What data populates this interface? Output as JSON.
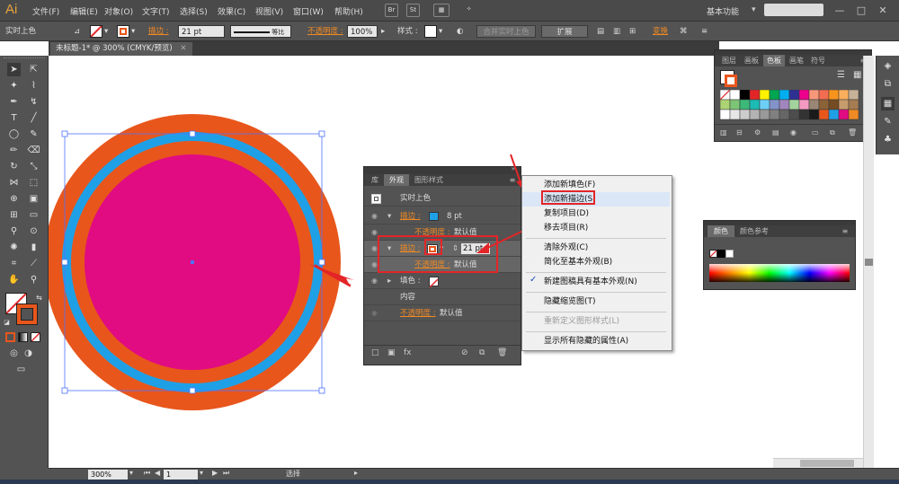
{
  "app": {
    "logo": "Ai",
    "menus": [
      "文件(F)",
      "编辑(E)",
      "对象(O)",
      "文字(T)",
      "选择(S)",
      "效果(C)",
      "视图(V)",
      "窗口(W)",
      "帮助(H)"
    ],
    "menu_icons": [
      "Br",
      "St"
    ],
    "workspace": "基本功能",
    "search_placeholder": "",
    "window_buttons": [
      "—",
      "□",
      "✕"
    ]
  },
  "control_bar": {
    "selection_label": "实时上色",
    "stroke_label": "描边 :",
    "stroke_weight": "21 pt",
    "brush_label": "等比",
    "opacity_label": "不透明度 :",
    "opacity_value": "100%",
    "style_label": "样式 :",
    "merge_button": "合并实时上色",
    "expand_button": "扩展",
    "transform_button": "变换"
  },
  "document": {
    "tab_title": "未标题-1* @ 300% (CMYK/预览)"
  },
  "appearance_panel": {
    "tabs": [
      "库",
      "外观",
      "图形样式"
    ],
    "active_tab": "外观",
    "header": "实时上色",
    "rows": [
      {
        "label": "描边 :",
        "value": "8 pt",
        "swatch": "#1fa0e6"
      },
      {
        "label": "不透明度 :",
        "value": "默认值"
      },
      {
        "label": "描边 :",
        "value": "21 pt",
        "swatch": "#f08a24"
      },
      {
        "label": "不透明度 :",
        "value": "默认值"
      },
      {
        "label": "填色 :",
        "value": ""
      },
      {
        "label": "内容",
        "value": ""
      },
      {
        "label": "不透明度 :",
        "value": "默认值"
      }
    ]
  },
  "flyout_menu": {
    "items": [
      {
        "label": "添加新填色(F)",
        "enabled": true
      },
      {
        "label": "添加新描边(S)",
        "enabled": true
      },
      {
        "label": "复制项目(D)",
        "enabled": true
      },
      {
        "label": "移去项目(R)",
        "enabled": true
      },
      {
        "label": "清除外观(C)",
        "enabled": true
      },
      {
        "label": "简化至基本外观(B)",
        "enabled": true
      },
      {
        "label": "新建图稿具有基本外观(N)",
        "enabled": true,
        "checked": true
      },
      {
        "label": "隐藏缩览图(T)",
        "enabled": true
      },
      {
        "label": "重新定义图形样式(L)",
        "enabled": false
      },
      {
        "label": "显示所有隐藏的属性(A)",
        "enabled": true
      }
    ],
    "check_mark": "✓"
  },
  "swatches_panel": {
    "tabs": [
      "图层",
      "画板",
      "色板",
      "画笔",
      "符号"
    ],
    "active_tab": "色板"
  },
  "color_panel": {
    "tabs": [
      "颜色",
      "颜色参考"
    ],
    "active_tab": "颜色"
  },
  "status_bar": {
    "zoom": "300%",
    "artboard": "1",
    "tool_status": "选择"
  },
  "colors": {
    "orange": "#e8561c",
    "blue": "#1fa0e6",
    "magenta": "#e10b82",
    "ui_dark": "#535353",
    "highlight_red": "#e32528"
  }
}
